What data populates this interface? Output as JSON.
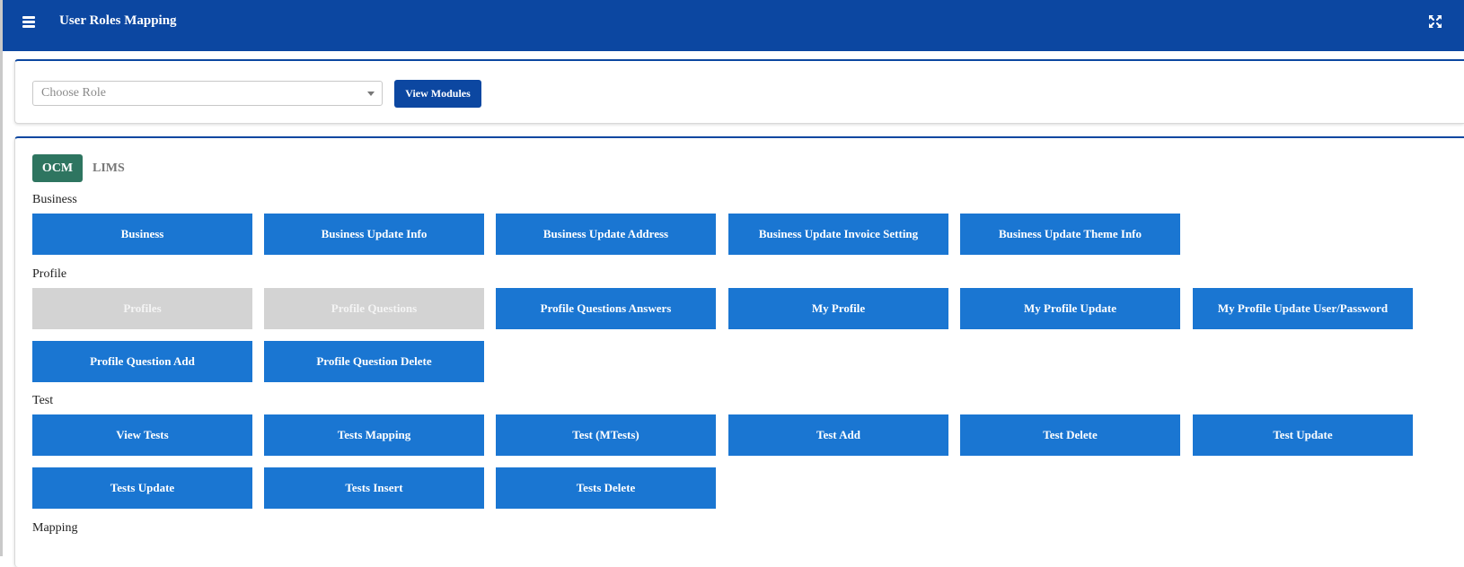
{
  "header": {
    "title": "User Roles Mapping",
    "background": "#0c47a1",
    "menu_icon": "hamburger-menu-icon",
    "fullscreen_icon": "expand-arrows-icon"
  },
  "role_filter": {
    "select_placeholder": "Choose Role",
    "view_button_label": "View Modules"
  },
  "tabs": [
    {
      "label": "OCM",
      "active": true
    },
    {
      "label": "LIMS",
      "active": false
    }
  ],
  "sections": {
    "business": {
      "title": "Business",
      "buttons": [
        {
          "label": "Business",
          "enabled": true
        },
        {
          "label": "Business Update Info",
          "enabled": true
        },
        {
          "label": "Business Update Address",
          "enabled": true
        },
        {
          "label": "Business Update Invoice Setting",
          "enabled": true
        },
        {
          "label": "Business Update Theme Info",
          "enabled": true
        }
      ]
    },
    "profile": {
      "title": "Profile",
      "buttons": [
        {
          "label": "Profiles",
          "enabled": false
        },
        {
          "label": "Profile Questions",
          "enabled": false
        },
        {
          "label": "Profile Questions Answers",
          "enabled": true
        },
        {
          "label": "My Profile",
          "enabled": true
        },
        {
          "label": "My Profile Update",
          "enabled": true
        },
        {
          "label": "My Profile Update User/Password",
          "enabled": true
        },
        {
          "label": "Profile Question Add",
          "enabled": true
        },
        {
          "label": "Profile Question Delete",
          "enabled": true
        }
      ]
    },
    "test": {
      "title": "Test",
      "buttons": [
        {
          "label": "View Tests",
          "enabled": true
        },
        {
          "label": "Tests Mapping",
          "enabled": true
        },
        {
          "label": "Test (MTests)",
          "enabled": true
        },
        {
          "label": "Test Add",
          "enabled": true
        },
        {
          "label": "Test Delete",
          "enabled": true
        },
        {
          "label": "Test Update",
          "enabled": true
        },
        {
          "label": "Tests Update",
          "enabled": true
        },
        {
          "label": "Tests Insert",
          "enabled": true
        },
        {
          "label": "Tests Delete",
          "enabled": true
        }
      ]
    },
    "mapping": {
      "title": "Mapping"
    }
  },
  "colors": {
    "primary": "#0c47a1",
    "module_button": "#1a76d2",
    "module_button_disabled": "#d3d3d3",
    "active_tab": "#2e7560"
  }
}
